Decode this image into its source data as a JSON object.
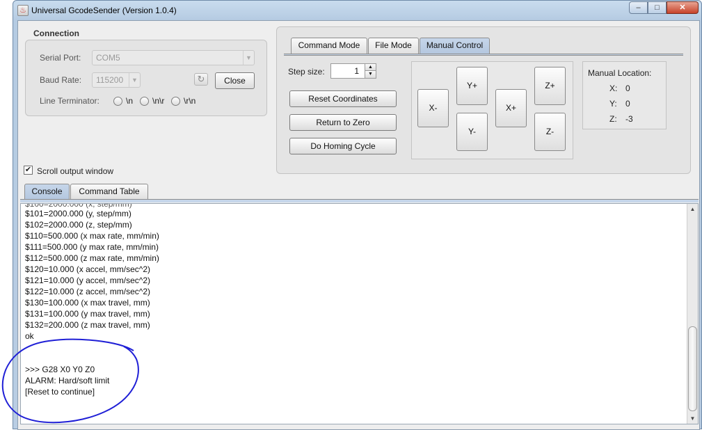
{
  "window": {
    "title": "Universal GcodeSender (Version 1.0.4)",
    "controls": {
      "minimize": "–",
      "maximize": "□",
      "close": "✕"
    }
  },
  "connection": {
    "title": "Connection",
    "serial_port_label": "Serial Port:",
    "serial_port_value": "COM5",
    "baud_rate_label": "Baud Rate:",
    "baud_rate_value": "115200",
    "close_button": "Close",
    "line_terminator_label": "Line Terminator:",
    "terminators": [
      "\\n",
      "\\n\\r",
      "\\r\\n"
    ]
  },
  "scroll_output": {
    "label": "Scroll output window",
    "checked": true
  },
  "mode_tabs": [
    "Command Mode",
    "File Mode",
    "Manual Control"
  ],
  "manual_control": {
    "step_size_label": "Step size:",
    "step_size_value": "1",
    "buttons": {
      "reset": "Reset Coordinates",
      "return_zero": "Return to Zero",
      "homing": "Do Homing Cycle"
    },
    "jog": {
      "x_minus": "X-",
      "y_plus": "Y+",
      "y_minus": "Y-",
      "x_plus": "X+",
      "z_plus": "Z+",
      "z_minus": "Z-"
    },
    "location": {
      "title": "Manual Location:",
      "x_label": "X:",
      "x": "0",
      "y_label": "Y:",
      "y": "0",
      "z_label": "Z:",
      "z": "-3"
    }
  },
  "bottom_tabs": [
    "Console",
    "Command Table"
  ],
  "console": {
    "lines": [
      "$101=2000.000 (y, step/mm)",
      "$102=2000.000 (z, step/mm)",
      "$110=500.000 (x max rate, mm/min)",
      "$111=500.000 (y max rate, mm/min)",
      "$112=500.000 (z max rate, mm/min)",
      "$120=10.000 (x accel, mm/sec^2)",
      "$121=10.000 (y accel, mm/sec^2)",
      "$122=10.000 (z accel, mm/sec^2)",
      "$130=100.000 (x max travel, mm)",
      "$131=100.000 (y max travel, mm)",
      "$132=200.000 (z max travel, mm)",
      "ok",
      "",
      "",
      ">>> G28 X0 Y0 Z0",
      "ALARM: Hard/soft limit",
      "[Reset to continue]"
    ]
  },
  "annotation_color": "#1f1fd6"
}
